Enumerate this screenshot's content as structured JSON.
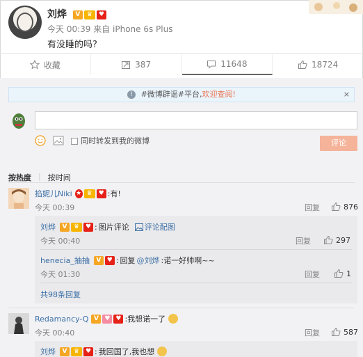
{
  "post": {
    "author": "刘烨",
    "meta": "今天 00:39 来自 iPhone 6s Plus",
    "text": "有没睡的吗?"
  },
  "actions": {
    "favorite": "收藏",
    "share_count": "387",
    "comment_count": "11648",
    "like_count": "18724"
  },
  "notice": {
    "prefix": "#微博辟谣#平台,",
    "link": "欢迎查阅!",
    "close": "×"
  },
  "composer": {
    "input_value": "",
    "forward_label": "同时转发到我的微博",
    "submit_label": "评论"
  },
  "sort": {
    "hot": "按热度",
    "time": "按时间"
  },
  "comments": [
    {
      "user": "掐妮儿Niki",
      "text": "有!",
      "time": "今天 00:39",
      "reply_label": "回复",
      "likes": "876",
      "replies": [
        {
          "user": "刘烨",
          "text": "图片评论",
          "extra": "评论配图",
          "time": "今天 00:40",
          "reply_label": "回复",
          "likes": "297"
        },
        {
          "user": "henecia_抽抽",
          "text_prefix": "回复",
          "mention": "@刘烨",
          "text": ":诺一好帅啊~~",
          "time": "今天 01:30",
          "reply_label": "回复",
          "likes": "1"
        }
      ],
      "more": "共98条回复"
    },
    {
      "user": "Redamancy-Q",
      "text": "我想诺一了",
      "time": "今天 00:40",
      "reply_label": "回复",
      "likes": "587",
      "replies": [
        {
          "user": "刘烨",
          "text": "我回国了,我也想"
        }
      ]
    }
  ],
  "colors": {
    "link": "#3a6ea5",
    "accent": "#eb7350",
    "submit_bg": "#f5b39a",
    "panel_bg": "#f2f2f5"
  }
}
